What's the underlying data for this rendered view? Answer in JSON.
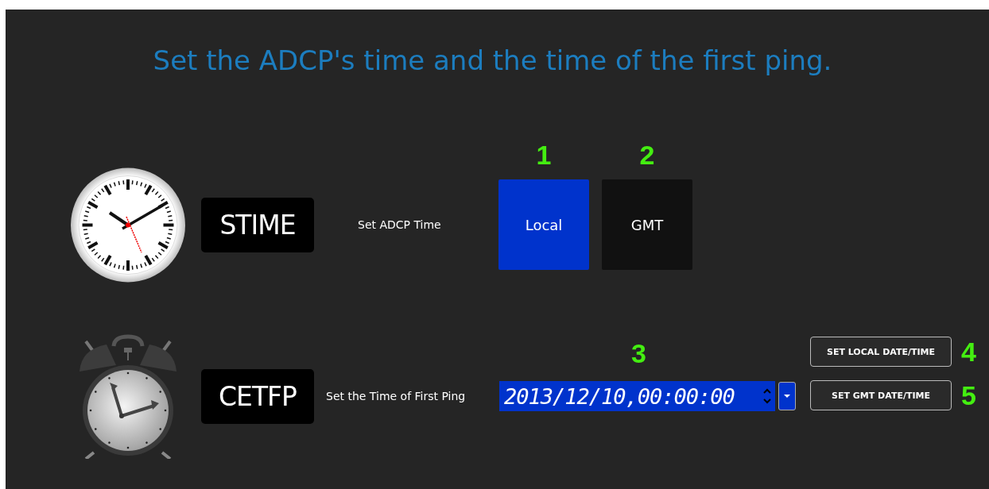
{
  "title": "Set the ADCP's time and the time of the first ping.",
  "rows": [
    {
      "kind": "mode",
      "command": "STIME",
      "label": "Set ADCP Time",
      "options": [
        {
          "label": "Local",
          "selected": true,
          "callout": "1"
        },
        {
          "label": "GMT",
          "selected": false,
          "callout": "2"
        }
      ]
    },
    {
      "kind": "datetime",
      "command": "CETFP",
      "label": "Set the Time of First Ping",
      "field": {
        "value": "2013/12/10,00:00:00",
        "callout": "3"
      },
      "buttons": [
        {
          "label": "SET LOCAL DATE/TIME",
          "callout": "4"
        },
        {
          "label": "SET GMT DATE/TIME",
          "callout": "5"
        }
      ]
    }
  ]
}
